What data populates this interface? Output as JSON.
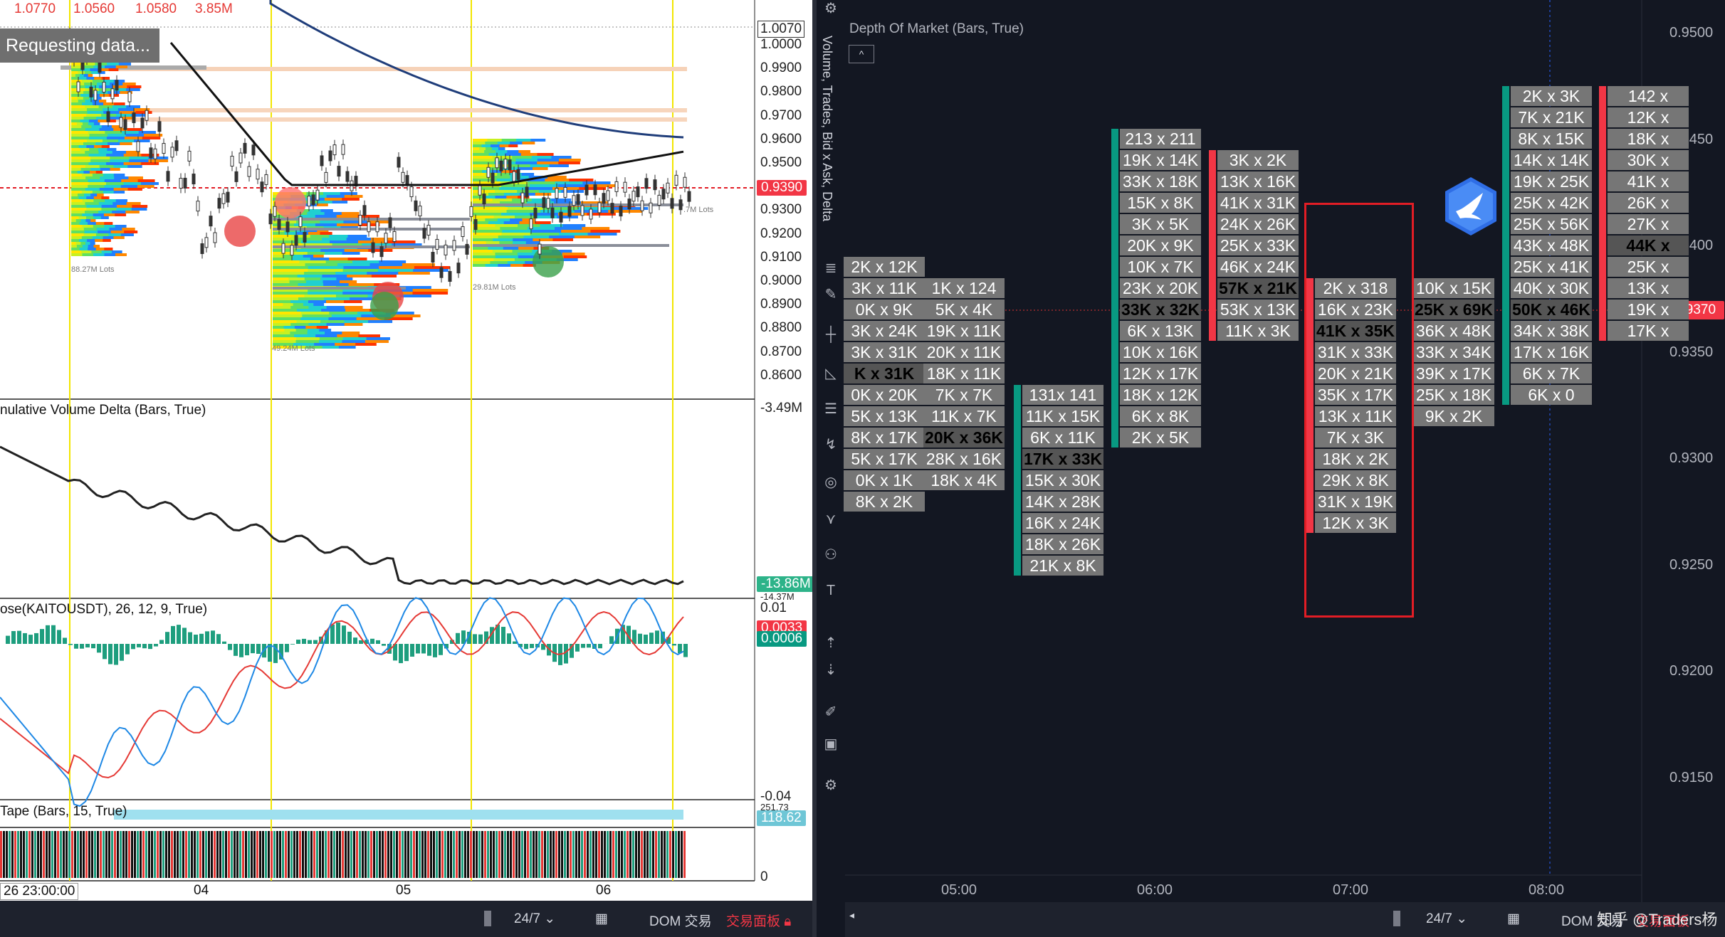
{
  "left_chart": {
    "header_values": [
      "1.0770",
      "1.0560",
      "1.0580",
      "3.85M"
    ],
    "requesting_label": "Requesting data...",
    "price_axis": [
      "1.0070",
      "1.0000",
      "0.9900",
      "0.9800",
      "0.9700",
      "0.9600",
      "0.9500",
      "0.9400",
      "0.9300",
      "0.9200",
      "0.9100",
      "0.9000",
      "0.8900",
      "0.8800",
      "0.8700",
      "0.8600"
    ],
    "price_tag": "0.9390",
    "profile_labels": [
      "88.27M Lots",
      "49.24M Lots",
      "29.81M Lots",
      ".7M Lots"
    ],
    "cvd_title": "nulative Volume Delta (Bars, True)",
    "cvd_axis_top": "-3.49M",
    "cvd_tag": "-13.86M",
    "cvd_axis_bottom": "-14.37M",
    "macd_title": "ose(KAITOUSDT), 26, 12, 9, True)",
    "macd_axis_top": "0.01",
    "macd_tag_red": "0.0033",
    "macd_tag_green": "0.0006",
    "macd_axis_bottom": "-0.04",
    "tape_title": "Tape (Bars, 15, True)",
    "tape_axis_top": "251.73",
    "tape_tag": "118.62",
    "tape_axis_bottom": "0",
    "time_axis": [
      "26 23:00:00",
      "04",
      "05",
      "06"
    ],
    "bottom_bar": {
      "interval": "24/7",
      "dom": "DOM 交易",
      "panel": "交易面板"
    }
  },
  "toolbar": {
    "vertical_label": "Volume, Trades, Bid x Ask, Delta",
    "icons": [
      "settings-gear-icon",
      "menu-lines-icon",
      "brush-icon",
      "crosshair-icon",
      "triangle-icon",
      "fib-icon",
      "curve-icon",
      "magnet-icon",
      "measure-icon",
      "nodes-icon",
      "text-icon",
      "sort-up-icon",
      "sort-down-icon",
      "pen-icon",
      "layout-icon",
      "gear-icon"
    ]
  },
  "dom_chart": {
    "title": "Depth Of Market (Bars, True)",
    "collapse_label": "^",
    "price_scale": [
      "0.9500",
      "0.9450",
      "0.9400",
      "0.9350",
      "0.9300",
      "0.9250",
      "0.9200",
      "0.9150"
    ],
    "current_price": "0.9370",
    "time_labels": [
      "05:00",
      "06:00",
      "07:00",
      "08:00"
    ],
    "columns": [
      {
        "top_row": 0,
        "bar": "none",
        "cells": [
          "2K x 12K",
          "3K x 11K",
          "0K x 9K",
          "3K x 24K",
          "3K x 31K",
          "K x 31K",
          "0K x 20K",
          "5K x 13K",
          "8K x 17K",
          "5K x 17K",
          "0K x 1K",
          "8K x 2K"
        ],
        "highlight": [
          5
        ]
      },
      {
        "top_row": 1,
        "bar": "none",
        "cells": [
          "1K x 124",
          "5K x 4K",
          "19K x 11K",
          "20K x 11K",
          "18K x 11K",
          "7K x 7K",
          "11K x 7K",
          "20K x 36K",
          "28K x 16K",
          "18K x 4K"
        ],
        "highlight": [
          7
        ]
      },
      {
        "top_row": 6,
        "bar": "green",
        "cells": [
          "131x 141",
          "11K x 15K",
          "6K x 11K",
          "17K x 33K",
          "15K x 30K",
          "14K x 28K",
          "16K x 24K",
          "18K x 26K",
          "21K x 8K"
        ],
        "highlight": [
          3
        ]
      },
      {
        "top_row": -6,
        "bar": "green",
        "cells": [
          "213 x 211",
          "19K x 14K",
          "33K x 18K",
          "15K x 8K",
          "3K x 5K",
          "20K x 9K",
          "10K x 7K",
          "23K x 20K",
          "33K x 32K",
          "6K x 13K",
          "10K x 16K",
          "12K x 17K",
          "18K x 12K",
          "6K x 8K",
          "2K x 5K"
        ],
        "highlight": [
          8
        ]
      },
      {
        "top_row": -5,
        "bar": "red",
        "cells": [
          "3K x 2K",
          "13K x 16K",
          "41K x 31K",
          "24K x 26K",
          "25K x 33K",
          "46K x 24K",
          "57K x 21K",
          "53K x 13K",
          "11K x 3K"
        ],
        "highlight": [
          6
        ]
      },
      {
        "top_row": 1,
        "bar": "red",
        "cells": [
          "2K x 318",
          "16K x 23K",
          "41K x 35K",
          "31K x 33K",
          "20K x 21K",
          "35K x 17K",
          "13K x 11K",
          "7K x 3K",
          "18K x 2K",
          "29K x 8K",
          "31K x 19K",
          "12K x 3K"
        ],
        "highlight": [
          2
        ]
      },
      {
        "top_row": 1,
        "bar": "none",
        "cells": [
          "10K x 15K",
          "25K x 69K",
          "36K x 48K",
          "33K x 34K",
          "39K x 17K",
          "25K x 18K",
          "9K x 2K"
        ],
        "highlight": [
          1
        ]
      },
      {
        "top_row": -8,
        "bar": "green",
        "cells": [
          "2K x 3K",
          "7K x 21K",
          "8K x 15K",
          "14K x 14K",
          "19K x 25K",
          "25K x 42K",
          "25K x 56K",
          "43K x 48K",
          "25K x 41K",
          "40K x 30K",
          "50K x 46K",
          "34K x 38K",
          "17K x 16K",
          "6K x 7K",
          "6K x 0"
        ],
        "highlight": [
          10
        ]
      },
      {
        "top_row": -8,
        "bar": "red",
        "cells": [
          "142 x",
          "12K x",
          "18K x",
          "30K x",
          "41K x",
          "26K x",
          "27K x",
          "44K x",
          "25K x",
          "13K x",
          "19K x",
          "17K x"
        ],
        "highlight": [
          7
        ]
      }
    ],
    "bottom_bar": {
      "interval": "24/7",
      "dom": "DOM 交易",
      "panel": "交易面板"
    },
    "watermark": "知乎 @Traders杨"
  },
  "colors": {
    "bg": "#131722",
    "cell": "#767676",
    "green": "#089981",
    "red": "#f23645",
    "box": "#e21d25"
  }
}
